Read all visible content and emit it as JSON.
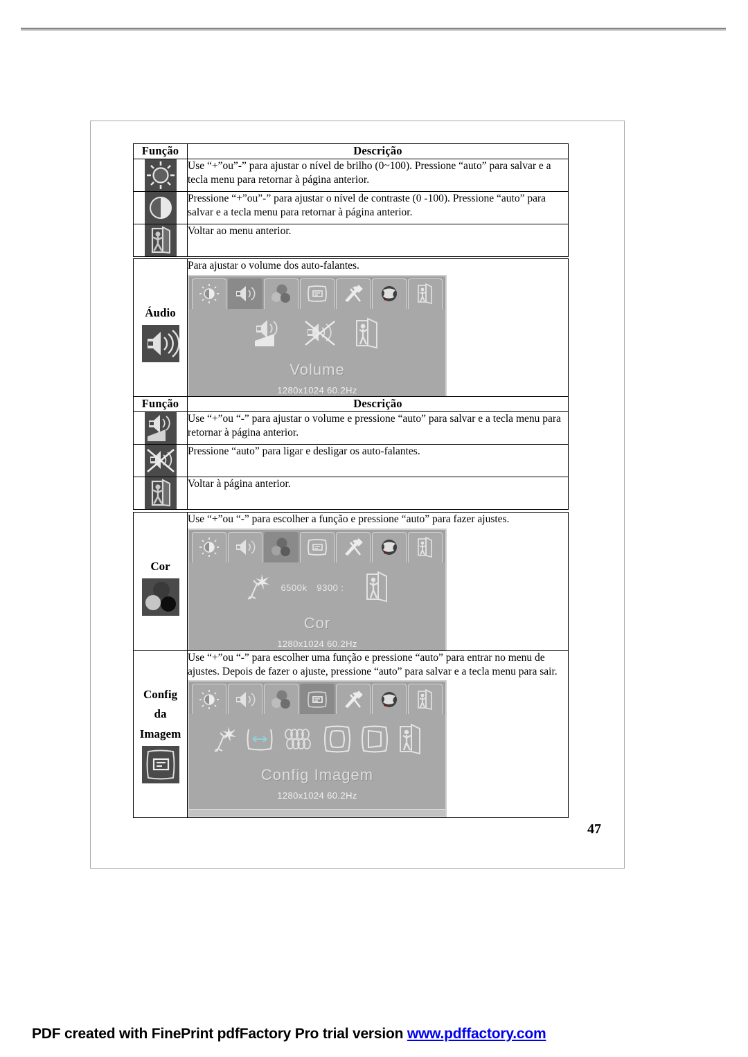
{
  "page": {
    "number": "47"
  },
  "footer": {
    "text": "PDF created with FinePrint pdfFactory Pro trial version ",
    "url": "www.pdffactory.com"
  },
  "table_headers": {
    "function": "Função",
    "description": "Descrição"
  },
  "brightness_table": {
    "rows": [
      {
        "icon": "brightness-icon",
        "description": "Use “+”ou”-” para ajustar o nível de brilho (0~100). Pressione “auto” para salvar e a tecla menu para retornar à página anterior."
      },
      {
        "icon": "contrast-icon",
        "description": "Pressione “+”ou”-” para ajustar o nível de contraste (0 -100). Pressione “auto” para salvar e a tecla menu para retornar à página anterior."
      },
      {
        "icon": "exit-icon",
        "description": "Voltar ao menu anterior."
      }
    ]
  },
  "audio_section": {
    "label": "Áudio",
    "icon": "speaker-icon",
    "description": "Para ajustar o volume dos auto-falantes.",
    "osd": {
      "tabs": [
        "brightness-tab-icon",
        "audio-tab-icon",
        "color-tab-icon",
        "image-config-tab-icon",
        "tools-tab-icon",
        "language-tab-icon",
        "exit-tab-icon"
      ],
      "selected_tab_index": 1,
      "items": [
        "volume-icon",
        "mute-icon",
        "exit-icon"
      ],
      "title": "Volume",
      "resolution": "1280x1024 60.2Hz"
    }
  },
  "audio_table": {
    "rows": [
      {
        "icon": "volume-icon",
        "description": "Use “+”ou “-” para ajustar o volume e pressione “auto” para salvar e a tecla menu para retornar à página anterior."
      },
      {
        "icon": "mute-icon",
        "description": "Pressione “auto” para ligar e desligar os auto-falantes."
      },
      {
        "icon": "exit-icon",
        "description": "Voltar à página anterior."
      }
    ]
  },
  "color_section": {
    "label": "Cor",
    "icon": "color-circles-icon",
    "description": "Use “+”ou “-” para escolher a função e pressione “auto” para fazer ajustes.",
    "osd": {
      "tabs": [
        "brightness-tab-icon",
        "audio-tab-icon",
        "color-tab-icon",
        "image-config-tab-icon",
        "tools-tab-icon",
        "language-tab-icon",
        "exit-tab-icon"
      ],
      "selected_tab_index": 2,
      "items": [
        "auto-color-icon",
        "6500k-label",
        "9300k-label",
        "rgb-sliders",
        "exit-icon"
      ],
      "kelvin_6500": "6500k",
      "kelvin_9300": "9300 :",
      "title": "Cor",
      "resolution": "1280x1024 60.2Hz"
    }
  },
  "image_config_section": {
    "label_line1": "Config",
    "label_line2": "da",
    "label_line3": "Imagem",
    "icon": "image-config-icon",
    "description": "Use “+”ou “-” para escolher uma função e pressione “auto” para entrar no menu de ajustes. Depois de fazer o ajuste, pressione “auto” para salvar e a tecla menu para sair.",
    "osd": {
      "tabs": [
        "brightness-tab-icon",
        "audio-tab-icon",
        "color-tab-icon",
        "image-config-tab-icon",
        "tools-tab-icon",
        "language-tab-icon",
        "exit-tab-icon"
      ],
      "selected_tab_index": 3,
      "items": [
        "auto-adjust-icon",
        "h-position-icon",
        "clock-phase-icon",
        "pincushion-icon",
        "trapezoid-icon",
        "exit-icon"
      ],
      "title": "Config Imagem",
      "resolution": "1280x1024 60.2Hz"
    }
  },
  "colors": {
    "osd_background": "#a8a8a8",
    "osd_selected_tab": "#8a8a8a",
    "icon_background": "#4a4a4a",
    "link": "#0000ee"
  }
}
